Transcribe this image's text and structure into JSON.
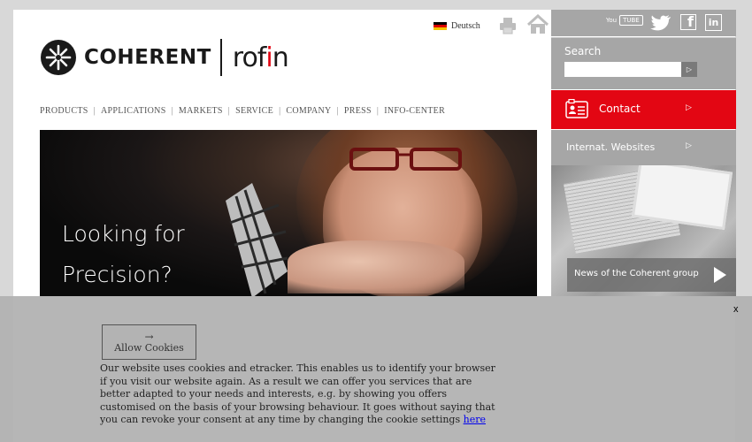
{
  "header": {
    "language_label": "Deutsch",
    "icons": {
      "flag": "german-flag-icon",
      "print": "printer-icon",
      "home": "home-icon"
    }
  },
  "logo": {
    "coherent": "COHERENT",
    "rofin_main": "rof",
    "rofin_i": "i",
    "rofin_end": "n"
  },
  "nav": {
    "items": [
      "PRODUCTS",
      "APPLICATIONS",
      "MARKETS",
      "SERVICE",
      "COMPANY",
      "PRESS",
      "INFO-CENTER"
    ],
    "separator": "|"
  },
  "hero": {
    "line1": "Looking for",
    "line2": "Precision?"
  },
  "sidebar": {
    "social": {
      "youtube_you": "You",
      "youtube_tube": "TUBE",
      "facebook": "f",
      "linkedin": "in"
    },
    "search": {
      "label": "Search",
      "button": "▷"
    },
    "contact": {
      "label": "Contact",
      "arrow": "▷"
    },
    "international": {
      "label": "Internat. Websites",
      "arrow": "▷"
    },
    "news": {
      "label": "News of the Coherent group"
    }
  },
  "cookie": {
    "close": "x",
    "allow_arrow": "→",
    "allow_label": "Allow Cookies",
    "text": "Our website uses cookies and etracker. This enables us to identify your browser if you visit our website again. As a result we can offer you services that are better adapted to your needs and interests, e.g. by showing you offers customised on the basis of your browsing behaviour. It goes without saying that you can revoke your consent at any time by changing the cookie settings ",
    "link": "here"
  },
  "colors": {
    "accent_red": "#e30613",
    "sidebar_gray": "#a6a6a6",
    "overlay_gray": "#b2b2b2"
  }
}
